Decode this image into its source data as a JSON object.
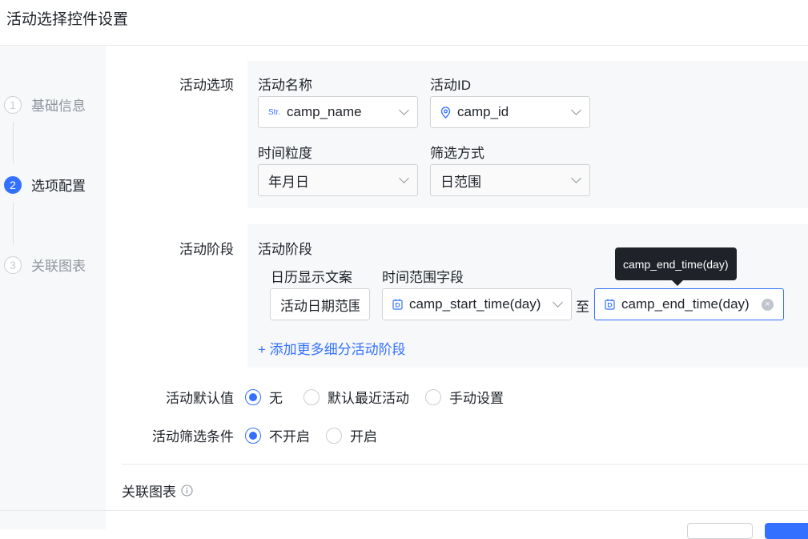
{
  "window": {
    "title": "活动选择控件设置"
  },
  "steps": [
    {
      "num": "1",
      "label": "基础信息"
    },
    {
      "num": "2",
      "label": "选项配置"
    },
    {
      "num": "3",
      "label": "关联图表"
    }
  ],
  "activity_options": {
    "section_label": "活动选项",
    "name_field": {
      "label": "活动名称",
      "value": "camp_name",
      "icon": "string-type-icon",
      "icon_text": "Str."
    },
    "id_field": {
      "label": "活动ID",
      "value": "camp_id",
      "icon": "location-pin-icon"
    },
    "granularity": {
      "label": "时间粒度",
      "value": "年月日"
    },
    "filter_mode": {
      "label": "筛选方式",
      "value": "日范围"
    }
  },
  "activity_stage": {
    "section_label": "活动阶段",
    "inner_title": "活动阶段",
    "calendar_text_label": "日历显示文案",
    "calendar_text_value": "活动日期范围",
    "time_range_label": "时间范围字段",
    "start_field": "camp_start_time(day)",
    "to_text": "至",
    "end_field": "camp_end_time(day)",
    "tooltip": "camp_end_time(day)",
    "add_link": "+ 添加更多细分活动阶段"
  },
  "default_value": {
    "label": "活动默认值",
    "options": [
      "无",
      "默认最近活动",
      "手动设置"
    ],
    "selected": 0
  },
  "filter_condition": {
    "label": "活动筛选条件",
    "options": [
      "不开启",
      "开启"
    ],
    "selected": 0
  },
  "linked_chart": {
    "label": "关联图表"
  },
  "colors": {
    "accent": "#3370ff",
    "panel": "#f7f8fa"
  }
}
